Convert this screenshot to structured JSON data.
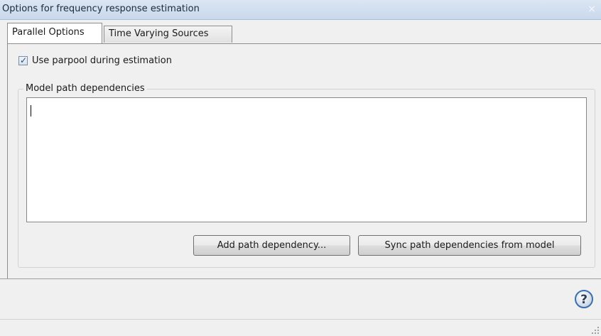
{
  "window": {
    "title": "Options for frequency response estimation",
    "close_glyph": "×"
  },
  "tabs": [
    {
      "label": "Parallel Options",
      "active": true
    },
    {
      "label": "Time Varying Sources",
      "active": false
    }
  ],
  "parallel": {
    "use_parpool": {
      "label": "Use parpool during estimation",
      "checked": true
    },
    "path_group": {
      "title": "Model path dependencies",
      "value": ""
    },
    "buttons": {
      "add_label": "Add path dependency...",
      "sync_label": "Sync path dependencies from model"
    }
  },
  "footer": {
    "help_icon": "help-icon",
    "resize_icon": "resize-grip-icon"
  },
  "colors": {
    "title_bar": "#c9d8ec",
    "background": "#f0f0f0",
    "help_blue": "#3a6fb0"
  }
}
